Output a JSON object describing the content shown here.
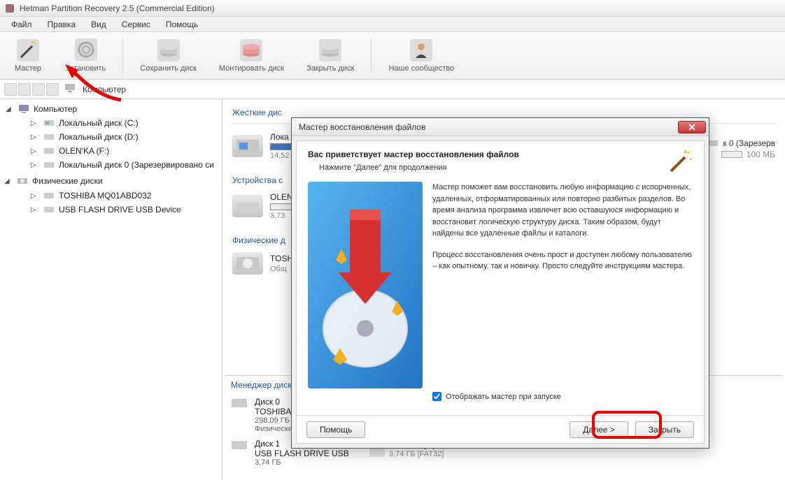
{
  "window_title": "Hetman Partition Recovery 2.5 (Commercial Edition)",
  "menu": [
    "Файл",
    "Правка",
    "Вид",
    "Сервис",
    "Помощь"
  ],
  "toolbar": [
    {
      "label": "Мастер",
      "icon": "wand"
    },
    {
      "label": "ⵆстановить",
      "icon": "refresh"
    },
    {
      "label": "Сохранить диск",
      "icon": "save-disk"
    },
    {
      "label": "Монтировать диск",
      "icon": "mount-disk"
    },
    {
      "label": "Закрыть диск",
      "icon": "close-disk"
    },
    {
      "label": "Наше сообщество",
      "icon": "community"
    }
  ],
  "breadcrumb": "Компьютер",
  "sidebar": {
    "root": "Компьютер",
    "drives": [
      "Локальный диск (C:)",
      "Локальный диск (D:)",
      "OLEN'KA (F:)",
      "Локальный диск 0 (Зарезервировано си"
    ],
    "phys_header": "Физические диски",
    "physical": [
      "TOSHIBA MQ01ABD032",
      "USB FLASH DRIVE USB Device"
    ]
  },
  "content": {
    "hard_header": "Жесткие дис",
    "local_c": "Лока",
    "local_c_size": "14,52",
    "devices_header": "Устройства с",
    "olen": "OLEN",
    "olen_size": "3,73",
    "phys_header": "Физические д",
    "tosh": "TOSH",
    "tosh_type": "Общ"
  },
  "right_info": {
    "line1": "к 0 (Зарезерв",
    "line2": "100 МБ"
  },
  "disk_manager": {
    "header": "Менеджер диск",
    "disk0": {
      "name": "Диск 0",
      "model": "TOSHIBA",
      "size": "298,09 ГБ",
      "type": "Физический диск"
    },
    "disk1": {
      "name": "Диск 1",
      "model": "USB FLASH DRIVE USB",
      "size": "3,74 ГБ"
    },
    "part_olen": {
      "name": "OLEN'KA (F:)",
      "detail": "3,74 ГБ [FAT32]"
    }
  },
  "dialog": {
    "title": "Мастер восстановления файлов",
    "heading": "Вас приветствует мастер восстановления файлов",
    "subheading": "Нажмите \"Далее\" для продолжения",
    "para1": "Мастер поможет вам восстановить любую информацию с испорченных, удаленных, отформатированных или повторно разбитых разделов. Во время анализа программа извлечет всю оставшуюся информацию и восстановит логическую структуру диска. Таким образом, будут найдены все удаленные файлы и каталоги.",
    "para2": "Процесс восстановления очень прост и доступен любому пользователю – как опытному, так и новичку. Просто следуйте инструкциям мастера.",
    "checkbox": "Отображать мастер при запуске",
    "btn_help": "Помощь",
    "btn_next": "Далее >",
    "btn_close": "Закрыть"
  }
}
